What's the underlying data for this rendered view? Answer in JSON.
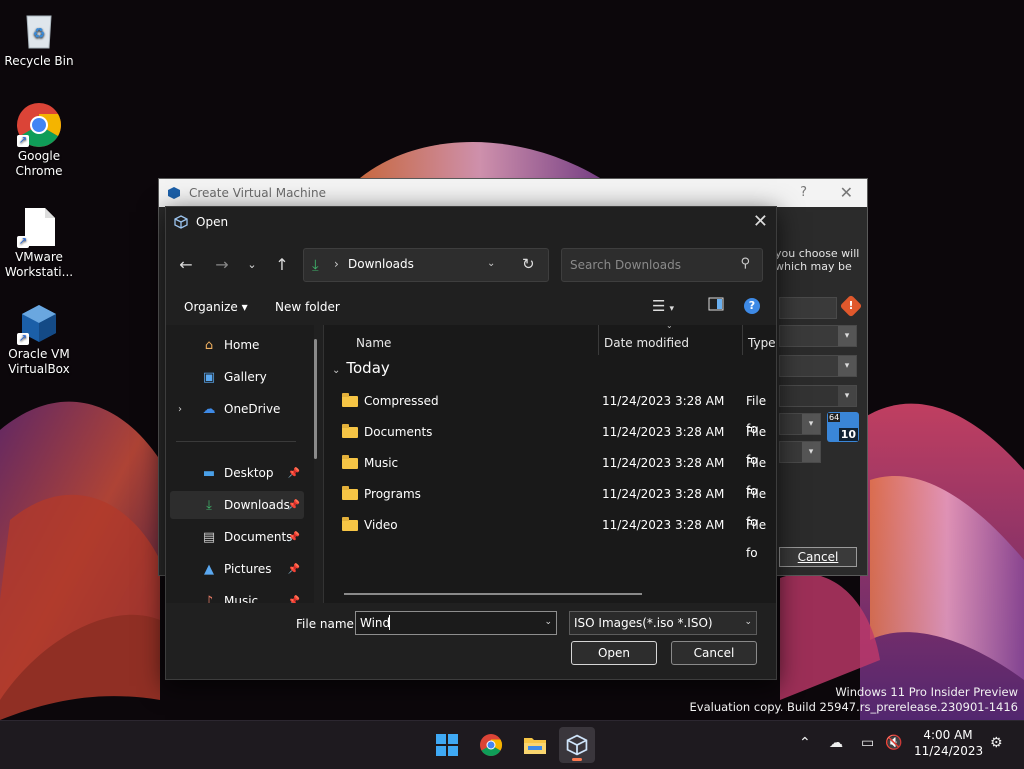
{
  "desktop": {
    "icons": [
      {
        "label": "Recycle Bin"
      },
      {
        "label": "Google\nChrome"
      },
      {
        "label": "VMware\nWorkstati..."
      },
      {
        "label": "Oracle VM\nVirtualBox"
      }
    ]
  },
  "create_vm": {
    "title": "Create Virtual Machine",
    "help_glyph": "?",
    "close_glyph": "✕",
    "partial_text": "you choose will\n which may be",
    "cancel_label": "Cancel",
    "badge_64": "64",
    "badge_10": "10"
  },
  "open_dialog": {
    "title": "Open",
    "close_glyph": "✕",
    "address": {
      "path": "Downloads"
    },
    "search": {
      "placeholder": "Search Downloads"
    },
    "commands": {
      "organize": "Organize ▾",
      "new_folder": "New folder"
    },
    "nav": [
      {
        "label": "Home",
        "icon": "home-icon"
      },
      {
        "label": "Gallery",
        "icon": "gallery-icon"
      },
      {
        "label": "OneDrive",
        "icon": "cloud-icon"
      },
      {
        "label": "Desktop",
        "icon": "desktop-icon"
      },
      {
        "label": "Downloads",
        "icon": "download-icon"
      },
      {
        "label": "Documents",
        "icon": "document-icon"
      },
      {
        "label": "Pictures",
        "icon": "pictures-icon"
      },
      {
        "label": "Music",
        "icon": "music-icon"
      }
    ],
    "columns": {
      "name": "Name",
      "date": "Date modified",
      "type": "Type"
    },
    "group": "Today",
    "rows": [
      {
        "name": "Compressed",
        "date": "11/24/2023 3:28 AM",
        "type": "File fo"
      },
      {
        "name": "Documents",
        "date": "11/24/2023 3:28 AM",
        "type": "File fo"
      },
      {
        "name": "Music",
        "date": "11/24/2023 3:28 AM",
        "type": "File fo"
      },
      {
        "name": "Programs",
        "date": "11/24/2023 3:28 AM",
        "type": "File fo"
      },
      {
        "name": "Video",
        "date": "11/24/2023 3:28 AM",
        "type": "File fo"
      }
    ],
    "file_name_label": "File name:",
    "file_name_value": "Wind",
    "file_type": "ISO Images(*.iso *.ISO)",
    "open_label": "Open",
    "cancel_label": "Cancel"
  },
  "watermark": {
    "line1": "Windows 11 Pro Insider Preview",
    "line2": "Evaluation copy. Build 25947.rs_prerelease.230901-1416"
  },
  "taskbar": {
    "time": "4:00 AM",
    "date": "11/24/2023"
  },
  "colors": {
    "accent": "#3e8ae6",
    "download_green": "#3fb56b",
    "folder_yellow": "#f6c545"
  }
}
